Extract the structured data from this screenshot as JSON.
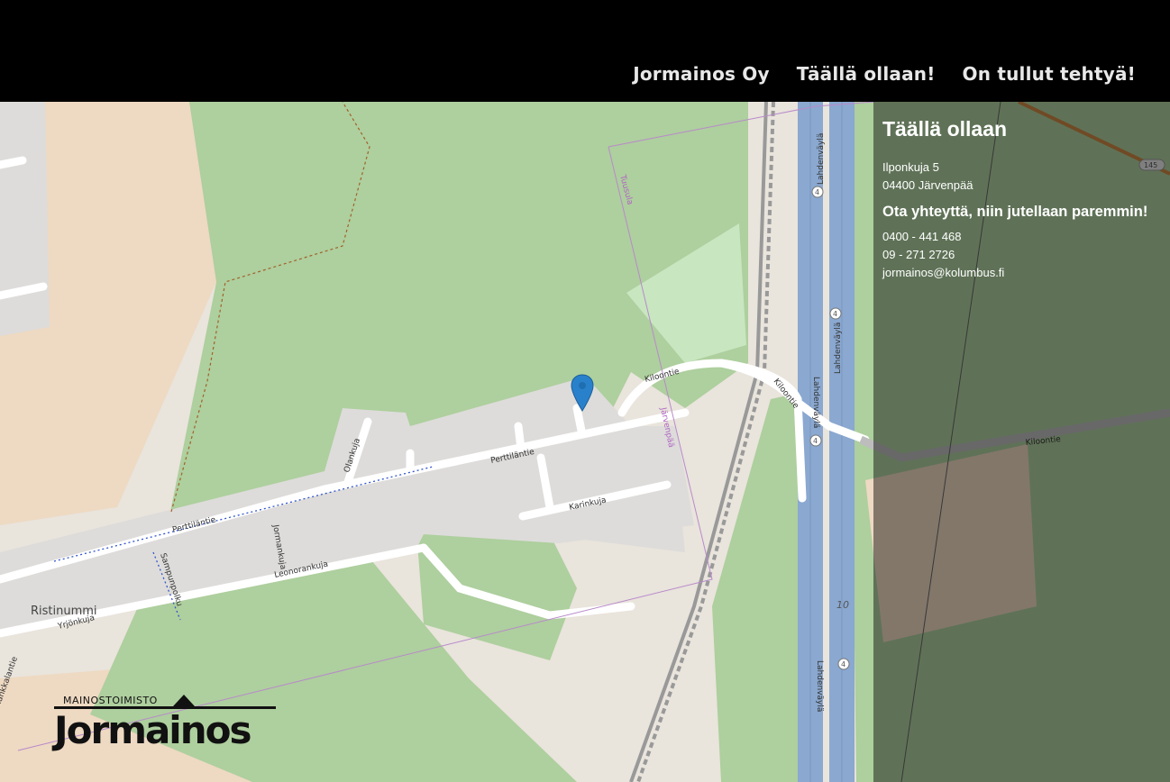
{
  "nav": {
    "items": [
      {
        "label": "Jormainos Oy"
      },
      {
        "label": "Täällä ollaan!"
      },
      {
        "label": "On tullut tehtyä!"
      }
    ]
  },
  "contact": {
    "title": "Täällä ollaan",
    "address_line1": "Ilponkuja 5",
    "address_line2": "04400 Järvenpää",
    "cta": "Ota yhteyttä, niin jutellaan paremmin!",
    "phone1": "0400 - 441 468",
    "phone2": "09 - 271 2726",
    "email": "jormainos@kolumbus.fi"
  },
  "map": {
    "streets": {
      "perttilantie_a": "Perttiläntie",
      "perttilantie_b": "Perttiläntie",
      "olankuja": "Olankuja",
      "jormankuja": "Jormankuja",
      "leonorankuja": "Leonorankuja",
      "sampunpolku": "Sampunpolku",
      "yrjonkuja": "Yrjönkuja",
      "karinkuja": "Karinkuja",
      "kiloontie_a": "Kiloontie",
      "kiloontie_b": "Kiloontie",
      "kiloontie_c": "Kiloontie",
      "lahdenvayla_a": "Lahdenväylä",
      "lahdenvayla_b": "Lahdenväylä",
      "lahdenvayla_c": "Lahdenväylä",
      "lahdenvayla_d": "Lahdenväylä",
      "tankkalantie": "Tankkalantie"
    },
    "places": {
      "ristinummi": "Ristinummi",
      "tuusula": "Tuusula",
      "jarvenpaa": "Järvenpää"
    },
    "road_shields": {
      "route4": "4",
      "route10": "10",
      "route145": "145"
    },
    "colors": {
      "forest": "#aecf9e",
      "residential": "#dddcda",
      "farmland": "#eed9c2",
      "motorway": "#8aa8d0"
    }
  },
  "logo": {
    "top_text": "MAINOSTOIMISTO",
    "main_text": "Jormainos"
  }
}
